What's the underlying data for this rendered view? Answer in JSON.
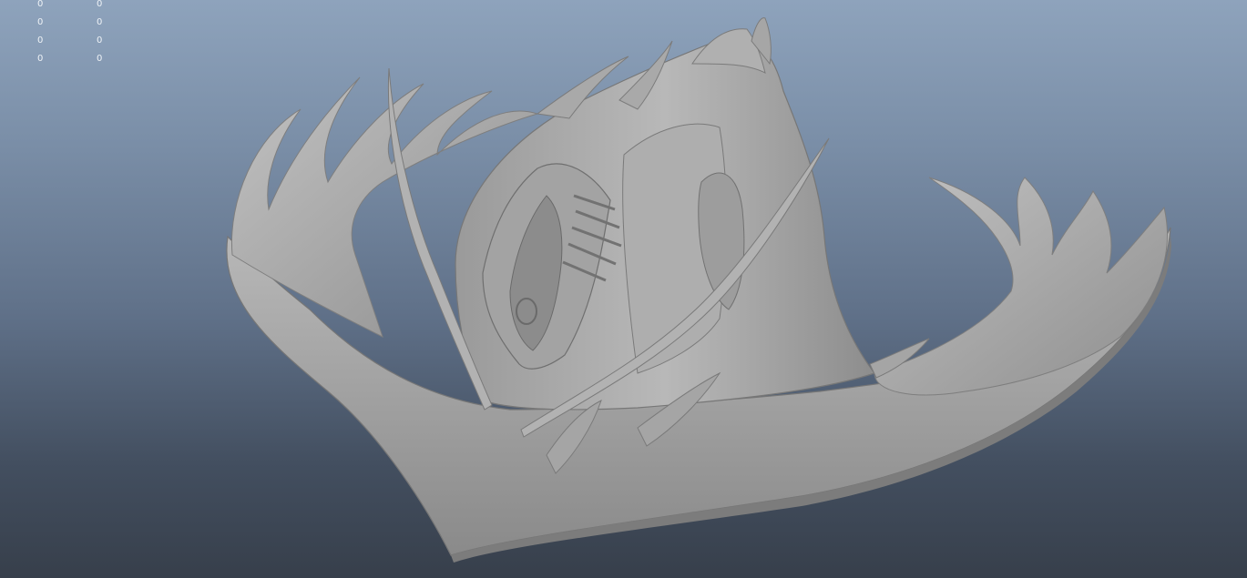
{
  "viewport": {
    "hud_stats": [
      {
        "col1": "0",
        "col2": "0"
      },
      {
        "col1": "0",
        "col2": "0"
      },
      {
        "col1": "0",
        "col2": "0"
      },
      {
        "col1": "0",
        "col2": "0"
      }
    ],
    "colors": {
      "background_top": "#8ea3bc",
      "background_bottom": "#373f4b",
      "mesh_light": "#b3b3b3",
      "mesh_mid": "#999999",
      "mesh_dark": "#6e6e6e",
      "hud_text": "#eef2f6"
    }
  }
}
